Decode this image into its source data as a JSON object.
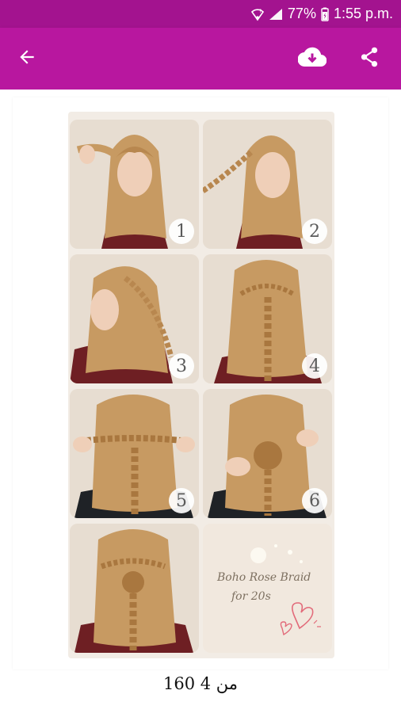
{
  "status_bar": {
    "battery": "77%",
    "time": "1:55 p.m."
  },
  "toolbar": {
    "back_icon": "arrow-back-icon",
    "download_icon": "cloud-download-icon",
    "share_icon": "share-icon"
  },
  "colors": {
    "status_bar": "#a3138f",
    "app_bar": "#b8179f"
  },
  "collage": {
    "steps": [
      "1",
      "2",
      "3",
      "4",
      "5",
      "6"
    ],
    "title_line1": "Boho Rose Braid",
    "title_line2": "for 20s"
  },
  "pager": {
    "text": "160 من 4"
  }
}
